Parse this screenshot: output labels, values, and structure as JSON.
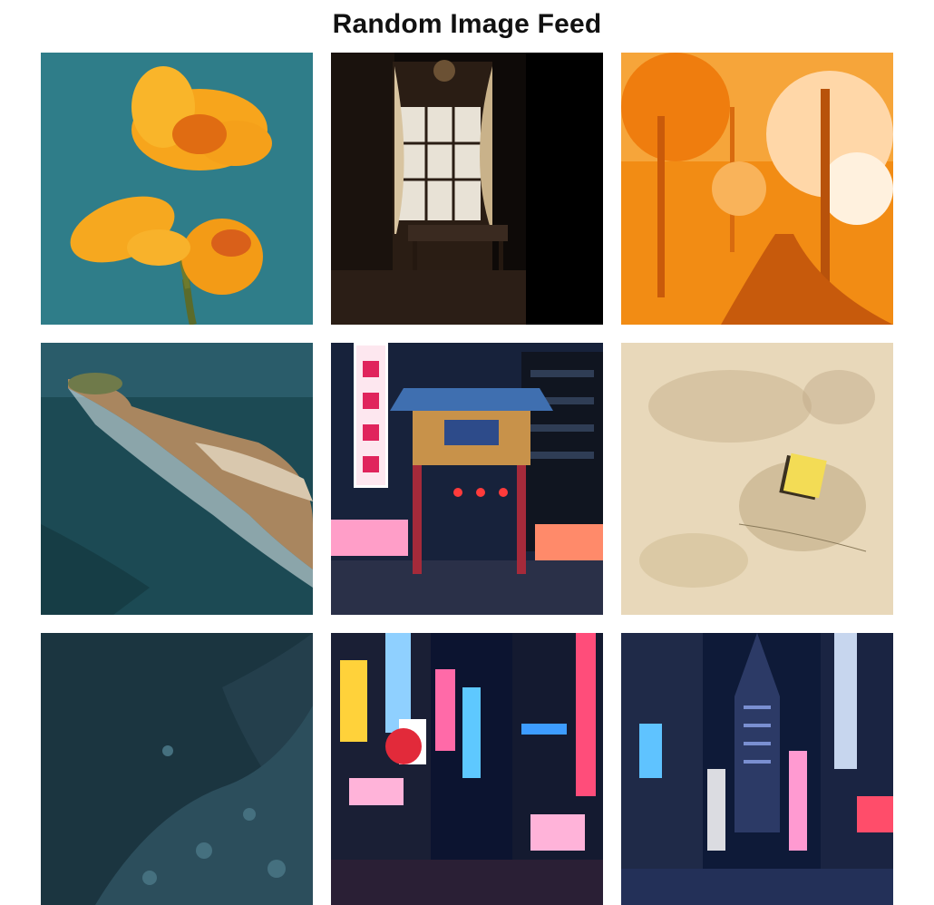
{
  "page": {
    "title": "Random Image Feed"
  },
  "feed": {
    "images": [
      {
        "subject": "orange canna flower against teal sky",
        "colors": [
          "#2e7a87",
          "#f5a21a"
        ]
      },
      {
        "subject": "dark room with window, curtains and table",
        "colors": [
          "#120d0a",
          "#d9c7a8"
        ]
      },
      {
        "subject": "orange autumn forest path",
        "colors": [
          "#f08a12",
          "#ffd39a"
        ]
      },
      {
        "subject": "aerial view of rocky coastline and sea",
        "colors": [
          "#1d4a52",
          "#c9a27c"
        ]
      },
      {
        "subject": "chinatown gate with neon signs at night",
        "colors": [
          "#1a2540",
          "#ff3d6e"
        ]
      },
      {
        "subject": "yellow sticky note on stained beige wall",
        "colors": [
          "#e6d6b8",
          "#f1d84a"
        ]
      },
      {
        "subject": "dark teal foliage",
        "colors": [
          "#1b3540",
          "#3c6373"
        ]
      },
      {
        "subject": "neon city street at night with signs",
        "colors": [
          "#0d1530",
          "#ff4d7a"
        ]
      },
      {
        "subject": "tokyo street with skyscraper and neon signs",
        "colors": [
          "#0f1a3a",
          "#5fc3ff"
        ]
      }
    ]
  }
}
